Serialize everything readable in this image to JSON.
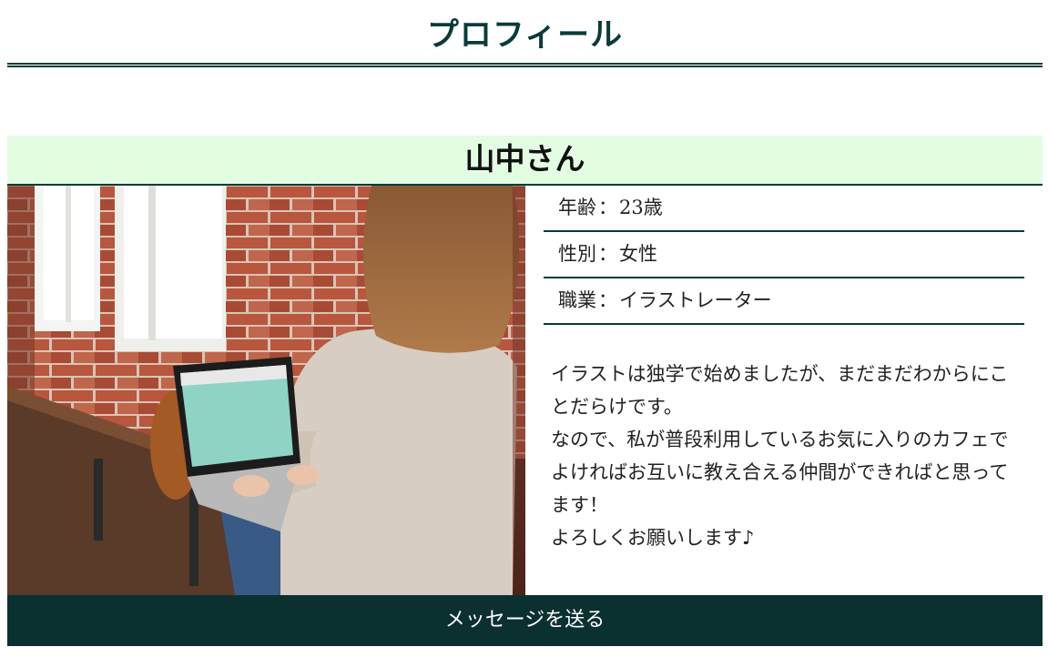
{
  "header": {
    "title": "プロフィール"
  },
  "profile": {
    "name": "山中さん",
    "details": [
      {
        "label": "年齢",
        "separator": "：",
        "value": "23歳"
      },
      {
        "label": "性別",
        "separator": "：",
        "value": "女性"
      },
      {
        "label": "職業",
        "separator": "：",
        "value": "イラストレーター"
      }
    ],
    "bio": [
      "イラストは独学で始めましたが、まだまだわからにことだらけです。",
      "なので、私が普段利用しているお気に入りのカフェでよければお互いに教え合える仲間ができればと思ってます！",
      "よろしくお願いします♪"
    ],
    "photo_icon": "woman-with-laptop-photo"
  },
  "actions": {
    "message_label": "メッセージを送る"
  },
  "colors": {
    "accent": "#0b3a3a",
    "name_band": "#e3fde3",
    "button_bg": "#0b3030"
  }
}
